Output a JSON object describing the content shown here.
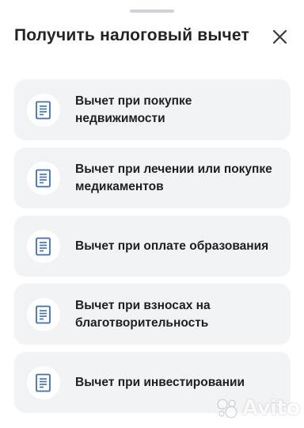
{
  "sheet": {
    "title": "Получить налоговый вычет",
    "close_icon": "close-icon"
  },
  "items": [
    {
      "label": "Вычет при покупке недвижимости",
      "icon": "document-icon"
    },
    {
      "label": "Вычет при лечении или покупке медикаментов",
      "icon": "document-icon"
    },
    {
      "label": "Вычет при оплате образования",
      "icon": "document-icon"
    },
    {
      "label": "Вычет при взносах на благотворительность",
      "icon": "document-icon"
    },
    {
      "label": "Вычет при инвестировании",
      "icon": "document-icon"
    }
  ],
  "watermark": {
    "text": "Avito"
  },
  "colors": {
    "card_background": "#f2f3f5",
    "icon_stroke": "#3d6fb5",
    "text": "#1e1f22"
  }
}
